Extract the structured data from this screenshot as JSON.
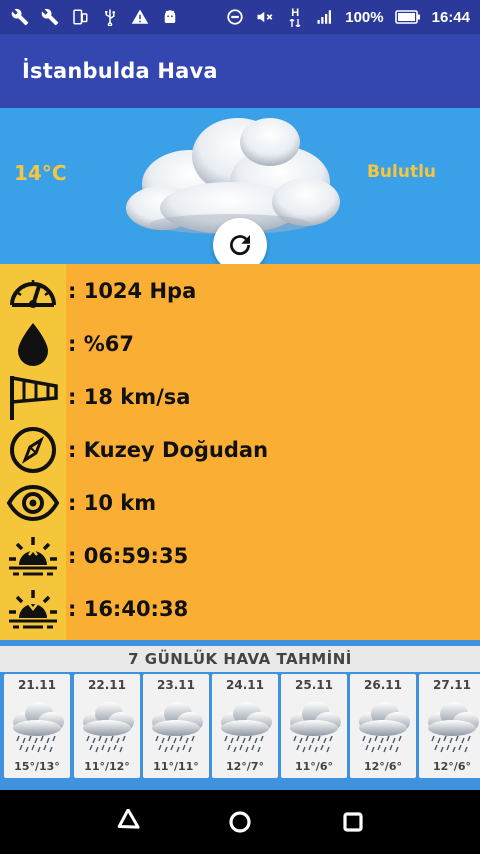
{
  "status_bar": {
    "battery_percent": "100%",
    "time": "16:44",
    "network_type": "H",
    "left_icons": [
      "wrench-icon",
      "wrench-icon",
      "phone-rotate-icon",
      "usb-icon",
      "warning-icon",
      "android-icon"
    ],
    "right_icons": [
      "do-not-disturb-icon",
      "mute-icon",
      "network-icon",
      "signal-icon",
      "battery-icon"
    ]
  },
  "app_bar": {
    "title": "İstanbulda Hava"
  },
  "current": {
    "temperature": "14°C",
    "condition": "Bulutlu",
    "icon": "cloud-icon",
    "refresh_icon": "refresh-icon"
  },
  "details": [
    {
      "icon": "pressure-gauge-icon",
      "text": ": 1024 Hpa"
    },
    {
      "icon": "humidity-drop-icon",
      "text": ": %67"
    },
    {
      "icon": "windsock-icon",
      "text": ": 18 km/sa"
    },
    {
      "icon": "compass-icon",
      "text": ": Kuzey Doğudan"
    },
    {
      "icon": "visibility-eye-icon",
      "text": ": 10 km"
    },
    {
      "icon": "sunrise-icon",
      "text": ": 06:59:35"
    },
    {
      "icon": "sunset-icon",
      "text": ": 16:40:38"
    }
  ],
  "forecast": {
    "title": "7 GÜNLÜK HAVA TAHMİNİ",
    "days": [
      {
        "date": "21.11",
        "temp": "15°/13°",
        "icon": "rain-cloud-icon"
      },
      {
        "date": "22.11",
        "temp": "11°/12°",
        "icon": "rain-cloud-icon"
      },
      {
        "date": "23.11",
        "temp": "11°/11°",
        "icon": "rain-cloud-icon"
      },
      {
        "date": "24.11",
        "temp": "12°/7°",
        "icon": "rain-cloud-icon"
      },
      {
        "date": "25.11",
        "temp": "11°/6°",
        "icon": "rain-cloud-icon"
      },
      {
        "date": "26.11",
        "temp": "12°/6°",
        "icon": "rain-cloud-icon"
      },
      {
        "date": "27.11",
        "temp": "12°/6°",
        "icon": "rain-cloud-icon"
      }
    ]
  },
  "nav_bar": {
    "icons": [
      "back-icon",
      "home-icon",
      "recents-icon"
    ]
  },
  "colors": {
    "status_bar": "#2b3a9a",
    "app_bar": "#3446b0",
    "hero_bg": "#3aa0e8",
    "accent_text": "#f6c640",
    "details_bg": "#fbae34",
    "icon_column": "#f6c63a",
    "forecast_bg": "#3e92de"
  }
}
